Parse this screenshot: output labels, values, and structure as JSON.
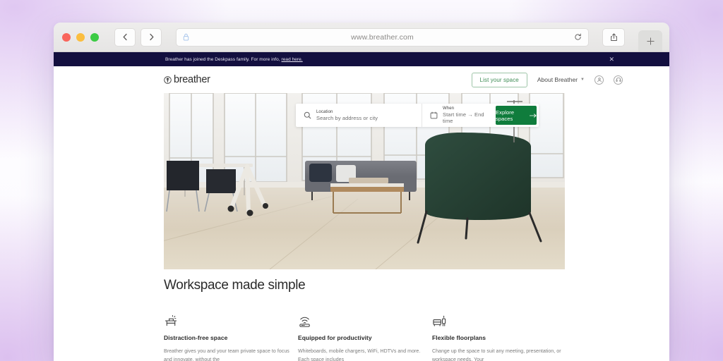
{
  "browser": {
    "url": "www.breather.com",
    "lock_icon": "lock-icon",
    "back_icon": "chevron-left-icon",
    "forward_icon": "chevron-right-icon",
    "reload_icon": "reload-icon",
    "share_icon": "share-icon",
    "new_tab_icon": "plus-icon",
    "traffic_lights": [
      "close-red",
      "minimize-yellow",
      "maximize-green"
    ]
  },
  "banner": {
    "text_before": "Breather has joined the Deskpass family. For more info, ",
    "link_text": "read here.",
    "close_icon": "close-icon",
    "background": "#130f3f"
  },
  "nav": {
    "logo_text": "breather",
    "logo_icon": "breather-logomark-icon",
    "list_space_label": "List your space",
    "about_label": "About Breather",
    "about_caret_icon": "chevron-down-icon",
    "account_icon": "user-circle-icon",
    "support_icon": "headset-circle-icon",
    "accent_green": "#3f8d56"
  },
  "search": {
    "location_label": "Location",
    "location_placeholder": "Search by address or city",
    "location_icon": "search-icon",
    "when_label": "When",
    "when_placeholder": "Start time → End time",
    "when_icon": "calendar-icon",
    "cta_label": "Explore spaces",
    "cta_arrow_icon": "arrow-right-icon",
    "cta_color": "#0f7c3c"
  },
  "features": {
    "section_title": "Workspace made simple",
    "items": [
      {
        "icon": "desk-lamp-icon",
        "title": "Distraction-free space",
        "body": "Breather gives you and your team private space to focus and innovate, without the"
      },
      {
        "icon": "wifi-router-icon",
        "title": "Equipped for productivity",
        "body": "Whiteboards, mobile chargers, WiFi, HDTVs and more. Each space includes"
      },
      {
        "icon": "furniture-floorplan-icon",
        "title": "Flexible floorplans",
        "body": "Change up the space to suit any meeting, presentation, or workspace needs. Your"
      }
    ]
  }
}
